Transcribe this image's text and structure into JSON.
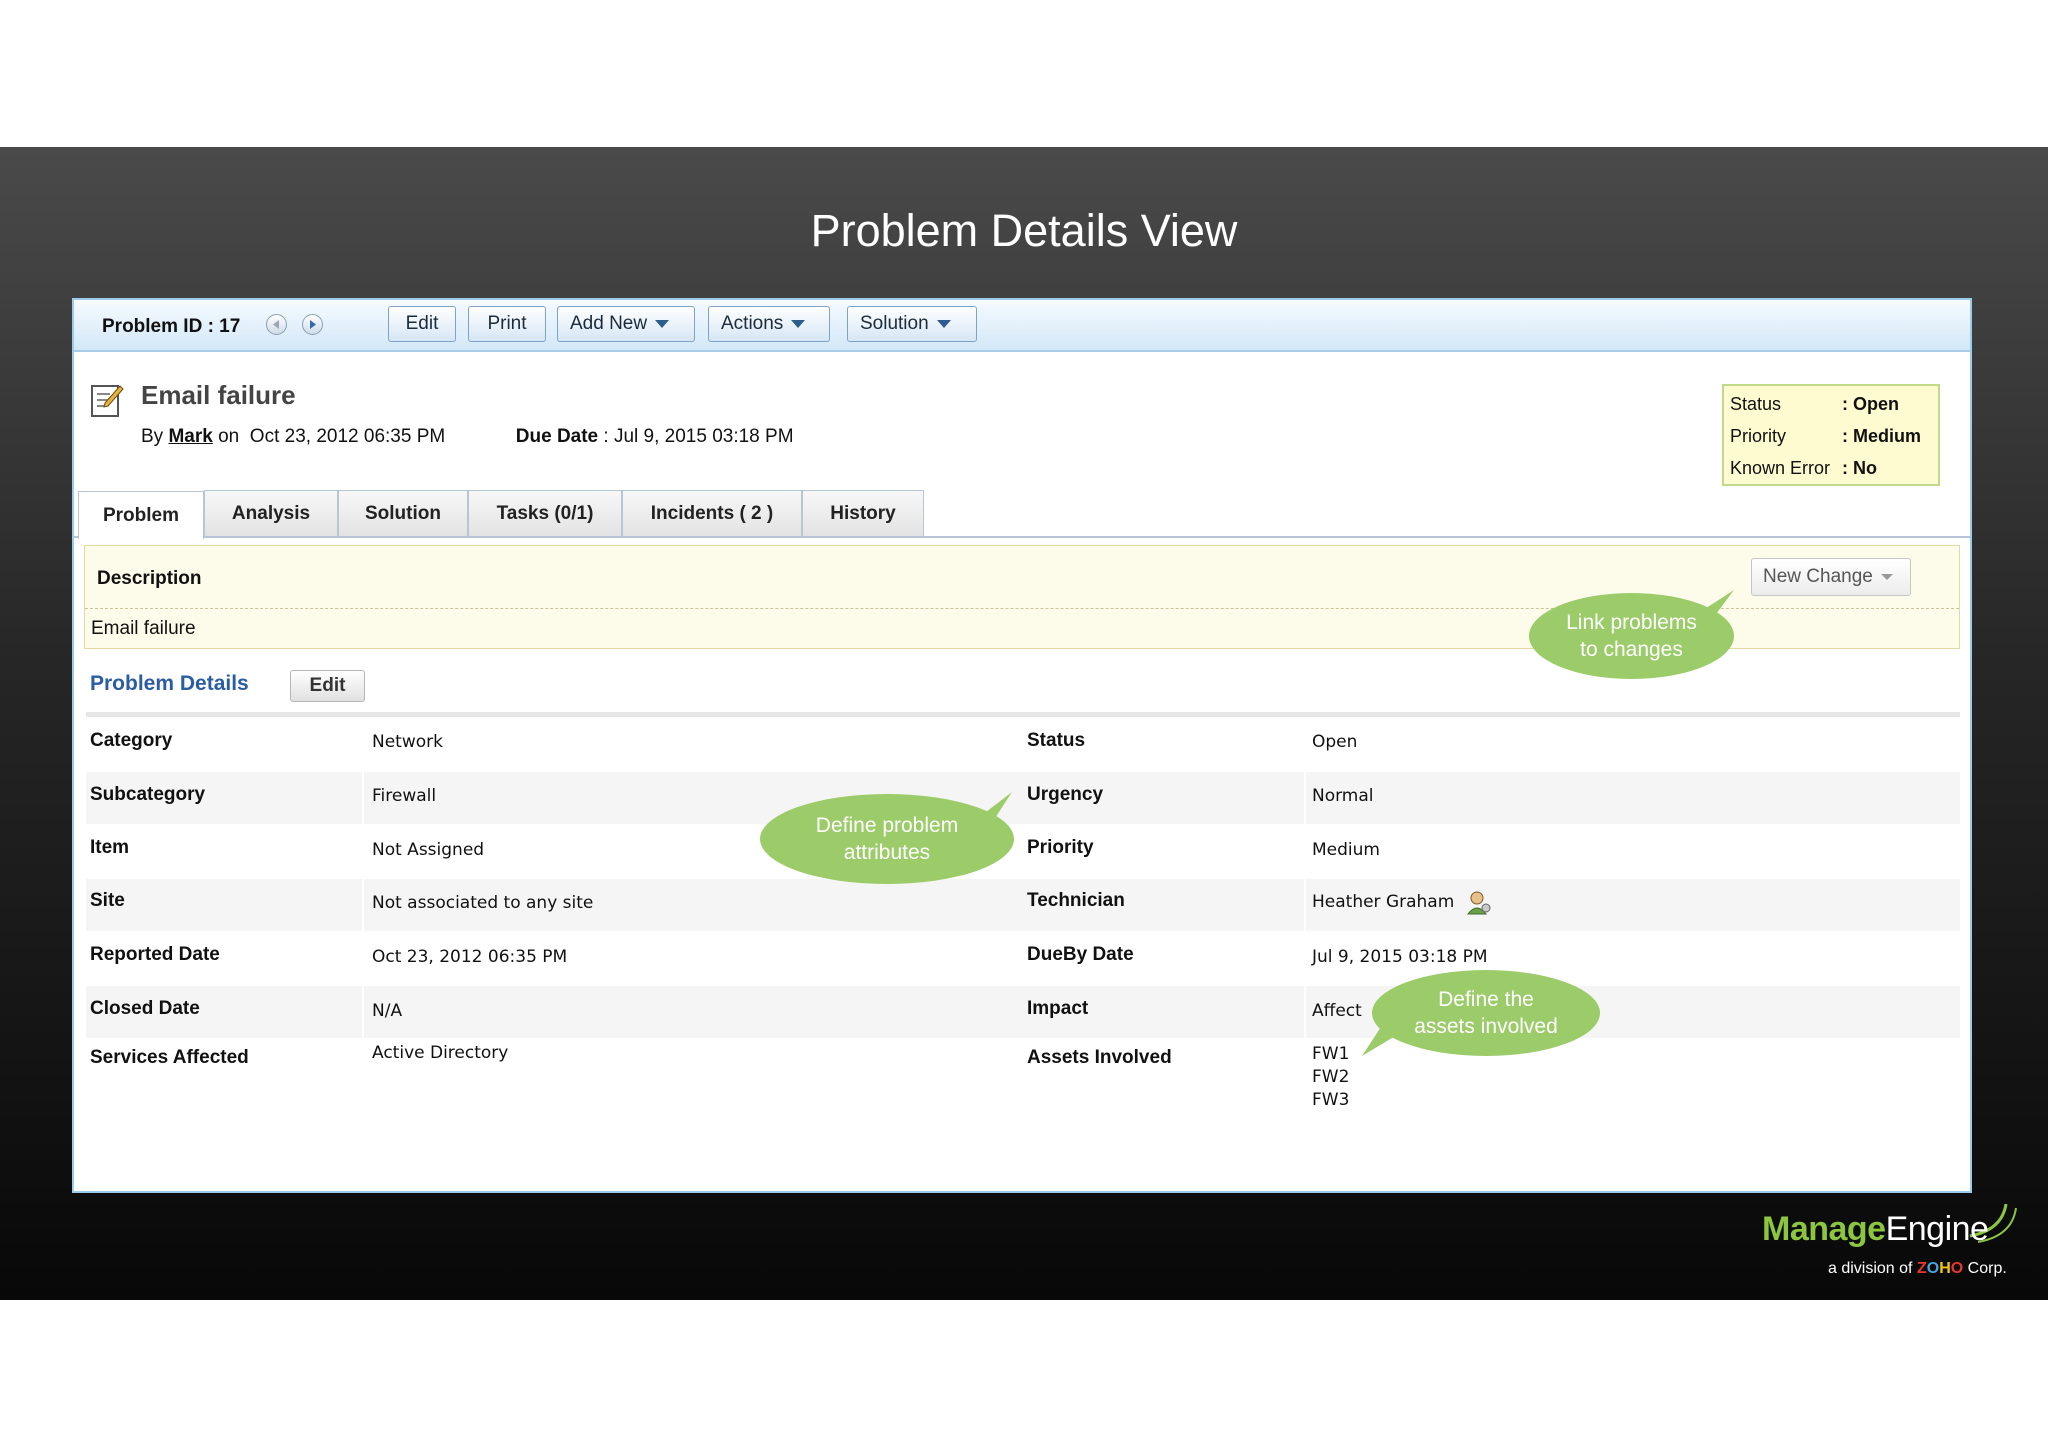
{
  "slide": {
    "title": "Problem Details View"
  },
  "toolbar": {
    "problem_id": "Problem ID : 17",
    "buttons": {
      "edit": "Edit",
      "print": "Print",
      "add_new": "Add New",
      "actions": "Actions",
      "solution": "Solution"
    }
  },
  "problem": {
    "title": "Email failure",
    "by_prefix": "By",
    "author": "Mark",
    "on_text": "on  Oct 23, 2012 06:35 PM",
    "due_label": "Due Date",
    "due_value": " : Jul 9, 2015 03:18 PM"
  },
  "status_box": {
    "rows": [
      {
        "label": "Status",
        "value": ": Open"
      },
      {
        "label": "Priority",
        "value": ": Medium"
      },
      {
        "label": "Known Error",
        "value": ": No"
      }
    ]
  },
  "tabs": [
    "Problem",
    "Analysis",
    "Solution",
    "Tasks (0/1)",
    "Incidents ( 2 )",
    "History"
  ],
  "description": {
    "label": "Description",
    "text": "Email failure",
    "new_change": "New Change"
  },
  "details": {
    "heading": "Problem Details",
    "edit": "Edit",
    "left": [
      {
        "label": "Category",
        "value": "Network"
      },
      {
        "label": "Subcategory",
        "value": "Firewall"
      },
      {
        "label": "Item",
        "value": "Not Assigned"
      },
      {
        "label": "Site",
        "value": "Not associated to any site"
      },
      {
        "label": "Reported Date",
        "value": "Oct 23, 2012 06:35 PM"
      },
      {
        "label": "Closed Date",
        "value": "N/A"
      },
      {
        "label": "Services Affected",
        "value": "Active Directory"
      }
    ],
    "right": [
      {
        "label": "Status",
        "value": "Open"
      },
      {
        "label": "Urgency",
        "value": "Normal"
      },
      {
        "label": "Priority",
        "value": "Medium"
      },
      {
        "label": "Technician",
        "value": "Heather Graham"
      },
      {
        "label": "DueBy Date",
        "value": "Jul 9, 2015 03:18 PM"
      },
      {
        "label": "Impact",
        "value": "Affect"
      },
      {
        "label": "Assets Involved",
        "value": "FW1"
      }
    ],
    "assets_extra": [
      "FW2",
      "FW3"
    ]
  },
  "callouts": {
    "link_changes": [
      "Link problems",
      "to changes"
    ],
    "define_attributes": [
      "Define problem",
      "attributes"
    ],
    "define_assets": [
      "Define the",
      "assets involved"
    ]
  },
  "logo": {
    "manage": "Manage",
    "engine": "Engine",
    "division": "a division of",
    "zoho_z": "Z",
    "zoho_o": "O",
    "zoho_h": "H",
    "zoho_o2": "O",
    "corp": "Corp."
  },
  "colors": {
    "callout_green": "#9ccc6a",
    "link_blue": "#2b5da3",
    "status_yellow": "#fffbd0"
  }
}
